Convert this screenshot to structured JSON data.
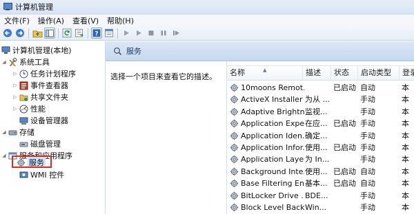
{
  "window": {
    "title": "计算机管理"
  },
  "menu": [
    "文件(F)",
    "操作(A)",
    "查看(V)",
    "帮助(H)"
  ],
  "toolbar": {
    "icons": [
      "back-icon",
      "forward-icon",
      "up-folder-icon",
      "show-hide-tree-icon",
      "refresh-icon",
      "export-list-icon",
      "help-icon",
      "properties-icon",
      "start-service-icon",
      "start-service-alt-icon",
      "stop-service-icon",
      "pause-service-icon",
      "restart-service-icon"
    ]
  },
  "tree": {
    "root": "计算机管理(本地)",
    "system_tools": "系统工具",
    "task_scheduler": "任务计划程序",
    "event_viewer": "事件查看器",
    "shared_folders": "共享文件夹",
    "performance": "性能",
    "device_manager": "设备管理器",
    "storage": "存储",
    "disk_management": "磁盘管理",
    "services_apps": "服务和应用程序",
    "services": "服务",
    "wmi": "WMI 控件"
  },
  "content": {
    "header_title": "服务",
    "description_prompt": "选择一个项目来查看它的描述。"
  },
  "services_table": {
    "columns": [
      "名称",
      "描述",
      "状态",
      "启动类型",
      "登录"
    ],
    "rows": [
      {
        "name": "10moons Remot...",
        "desc": "",
        "status": "已启动",
        "startup": "自动",
        "logon": "本"
      },
      {
        "name": "ActiveX Installer ...",
        "desc": "为从 ...",
        "status": "",
        "startup": "手动",
        "logon": "本"
      },
      {
        "name": "Adaptive Brightn...",
        "desc": "监视...",
        "status": "",
        "startup": "手动",
        "logon": "本"
      },
      {
        "name": "Application Expe...",
        "desc": "在应...",
        "status": "已启动",
        "startup": "手动",
        "logon": "本"
      },
      {
        "name": "Application Iden...",
        "desc": "确定...",
        "status": "",
        "startup": "手动",
        "logon": "本"
      },
      {
        "name": "Application Infor...",
        "desc": "使用...",
        "status": "已启动",
        "startup": "手动",
        "logon": "本"
      },
      {
        "name": "Application Laye...",
        "desc": "为 In...",
        "status": "",
        "startup": "手动",
        "logon": "本"
      },
      {
        "name": "Background Inte...",
        "desc": "使用...",
        "status": "已启动",
        "startup": "自动",
        "logon": "本"
      },
      {
        "name": "Base Filtering En...",
        "desc": "基本...",
        "status": "已启动",
        "startup": "自动",
        "logon": "本"
      },
      {
        "name": "BitLocker Drive ...",
        "desc": "BDE...",
        "status": "",
        "startup": "手动",
        "logon": "本"
      },
      {
        "name": "Block Level Back...",
        "desc": "Win...",
        "status": "",
        "startup": "手动",
        "logon": "本"
      }
    ]
  },
  "colors": {
    "highlight_border": "#e12a1f",
    "header_bg": "#c7d8ee",
    "selected_bg": "#cfe3fb"
  }
}
